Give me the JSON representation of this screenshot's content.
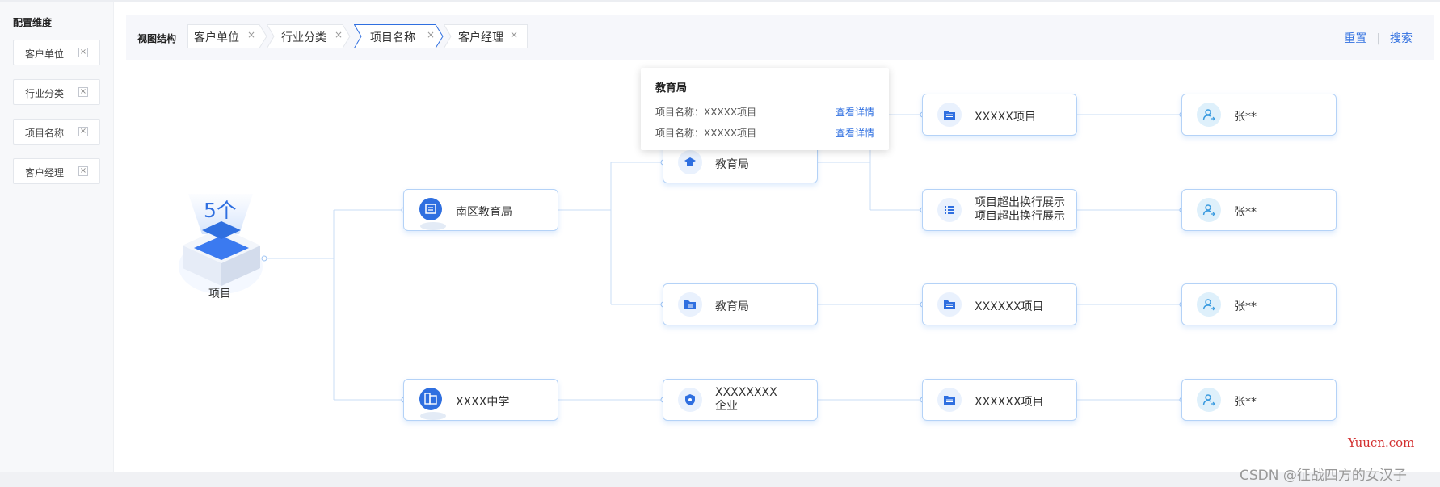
{
  "sidebar": {
    "title": "配置维度",
    "items": [
      {
        "label": "客户单位",
        "close": "×"
      },
      {
        "label": "行业分类",
        "close": "×"
      },
      {
        "label": "项目名称",
        "close": "×"
      },
      {
        "label": "客户经理",
        "close": "×"
      }
    ]
  },
  "crumbs": {
    "title": "视图结构",
    "items": [
      {
        "label": "客户单位",
        "close": "×"
      },
      {
        "label": "行业分类",
        "close": "×"
      },
      {
        "label": "项目名称",
        "close": "×"
      },
      {
        "label": "客户经理",
        "close": "×"
      }
    ],
    "active_index": 2
  },
  "actions": {
    "reset": "重置",
    "sep": "|",
    "search": "搜索"
  },
  "root": {
    "count": "5个",
    "label": "项目"
  },
  "nodes": {
    "n1": "南区教育局",
    "n2": "XXXX中学",
    "c1": "教育局",
    "c2": "教育局",
    "c3": {
      "line1": "XXXXXXXX",
      "line2": "企业"
    },
    "p1": "XXXXX项目",
    "p2": {
      "line1": "项目超出换行展示",
      "line2": "项目超出换行展示"
    },
    "p3": "XXXXXX项目",
    "p4": "XXXXXX项目",
    "m1": "张**",
    "m2": "张**",
    "m3": "张**",
    "m4": "张**"
  },
  "tooltip": {
    "title": "教育局",
    "rows": [
      {
        "text": "项目名称：XXXXX项目",
        "link": "查看详情"
      },
      {
        "text": "项目名称：XXXXX项目",
        "link": "查看详情"
      }
    ]
  },
  "watermark": {
    "site": "Yuucn.com",
    "author": "CSDN @征战四方的女汉子"
  },
  "colors": {
    "accent": "#2f6fe0",
    "node_border": "#b4d2f7",
    "line": "#c9dcf5"
  }
}
